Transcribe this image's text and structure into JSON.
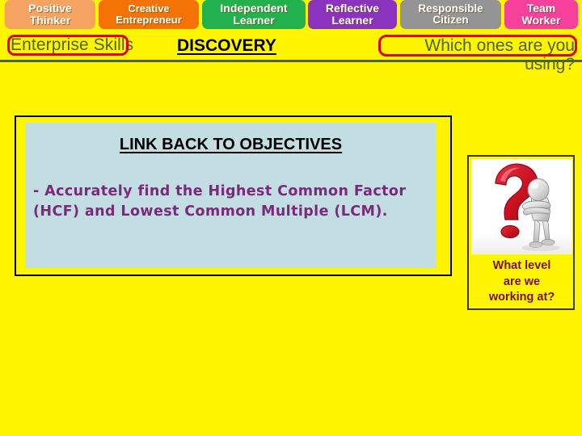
{
  "slide": {
    "background_color": "#FFF500",
    "accent_outline_color": "#E00000",
    "rule_color": "#4F6228"
  },
  "skill_tabs": [
    {
      "line1": "Positive",
      "line2": "Thinker",
      "color": "#F4A460"
    },
    {
      "line1": "Creative",
      "line2": "Entrepreneur",
      "color": "#F47206"
    },
    {
      "line1": "Independent",
      "line2": "Learner",
      "color": "#22B14C"
    },
    {
      "line1": "Reflective",
      "line2": "Learner",
      "color": "#8B32BE"
    },
    {
      "line1": "Responsible",
      "line2": "Citizen",
      "color": "#949494"
    },
    {
      "line1": "Team",
      "line2": "Worker",
      "color": "#F73F9C"
    }
  ],
  "header": {
    "enterprise_skills_label": "Enterprise Skills",
    "discovery_title": "DISCOVERY",
    "which_ones_line1": "Which ones are you",
    "which_ones_line2": "using?",
    "label_text_color": "#4F6228"
  },
  "objectives": {
    "heading": "LINK BACK TO OBJECTIVES",
    "body": "- Accurately find the Highest Common Factor (HCF) and Lowest Common Multiple (LCM).",
    "panel_fill_color": "#C2DEE2",
    "body_text_color": "#7B2A7B"
  },
  "level_card": {
    "image_icon": "question-mark-thinking-figure-icon",
    "caption_line1": "What level",
    "caption_line2": "are we",
    "caption_line3": "working at?",
    "caption_color": "#7B1020",
    "question_mark_color": "#CC1122"
  }
}
